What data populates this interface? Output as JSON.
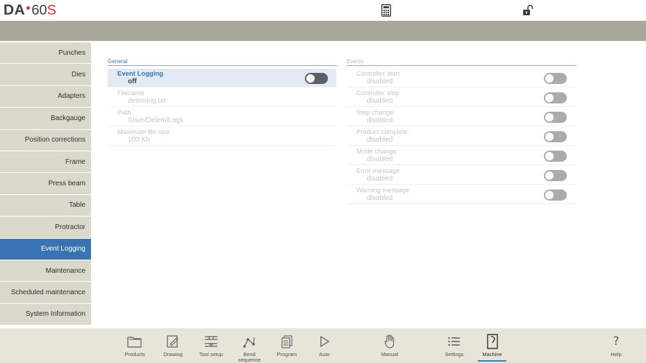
{
  "brand": {
    "prefix": "DA",
    "model_number": "60",
    "model_suffix": "S"
  },
  "topbar": {
    "calculator_icon": "calculator-icon",
    "lock_icon": "unlocked-padlock-icon"
  },
  "sidebar": {
    "items": [
      {
        "label": "Punches",
        "active": false
      },
      {
        "label": "Dies",
        "active": false
      },
      {
        "label": "Adapters",
        "active": false
      },
      {
        "label": "Backgauge",
        "active": false
      },
      {
        "label": "Position corrections",
        "active": false
      },
      {
        "label": "Frame",
        "active": false
      },
      {
        "label": "Press beam",
        "active": false
      },
      {
        "label": "Table",
        "active": false
      },
      {
        "label": "Protractor",
        "active": false
      },
      {
        "label": "Event Logging",
        "active": true
      },
      {
        "label": "Maintenance",
        "active": false
      },
      {
        "label": "Scheduled maintenance",
        "active": false
      },
      {
        "label": "System Information",
        "active": false
      }
    ]
  },
  "general": {
    "title": "General",
    "rows": [
      {
        "label": "Event Logging",
        "value": "off",
        "toggle": "off"
      },
      {
        "label": "Filename",
        "value": "delemlog.txt"
      },
      {
        "label": "Path",
        "value": "/User/Delem/Logs"
      },
      {
        "label": "Maximum file size",
        "value": "100 Kb"
      }
    ]
  },
  "events": {
    "title": "Events",
    "rows": [
      {
        "label": "Controller start",
        "value": "disabled",
        "toggle": "off"
      },
      {
        "label": "Controller stop",
        "value": "disabled",
        "toggle": "off"
      },
      {
        "label": "Step change",
        "value": "disabled",
        "toggle": "off"
      },
      {
        "label": "Product complete",
        "value": "disabled",
        "toggle": "off"
      },
      {
        "label": "Mode change",
        "value": "disabled",
        "toggle": "off"
      },
      {
        "label": "Error message",
        "value": "disabled",
        "toggle": "off"
      },
      {
        "label": "Warning message",
        "value": "disabled",
        "toggle": "off"
      }
    ]
  },
  "toolbar": {
    "products": "Products",
    "drawing": "Drawing",
    "tool_setup": "Tool setup",
    "bend_sequence": "Bend sequence",
    "program": "Program",
    "auto": "Auto",
    "manual": "Manual",
    "settings": "Settings",
    "machine": "Machine",
    "help": "Help",
    "active": "Machine"
  },
  "colors": {
    "accent": "#3a73b2",
    "band": "#aaa89a",
    "sidebar": "#dbd9cb",
    "bottombar": "#e7e5d7",
    "brand_red": "#c8383c"
  }
}
